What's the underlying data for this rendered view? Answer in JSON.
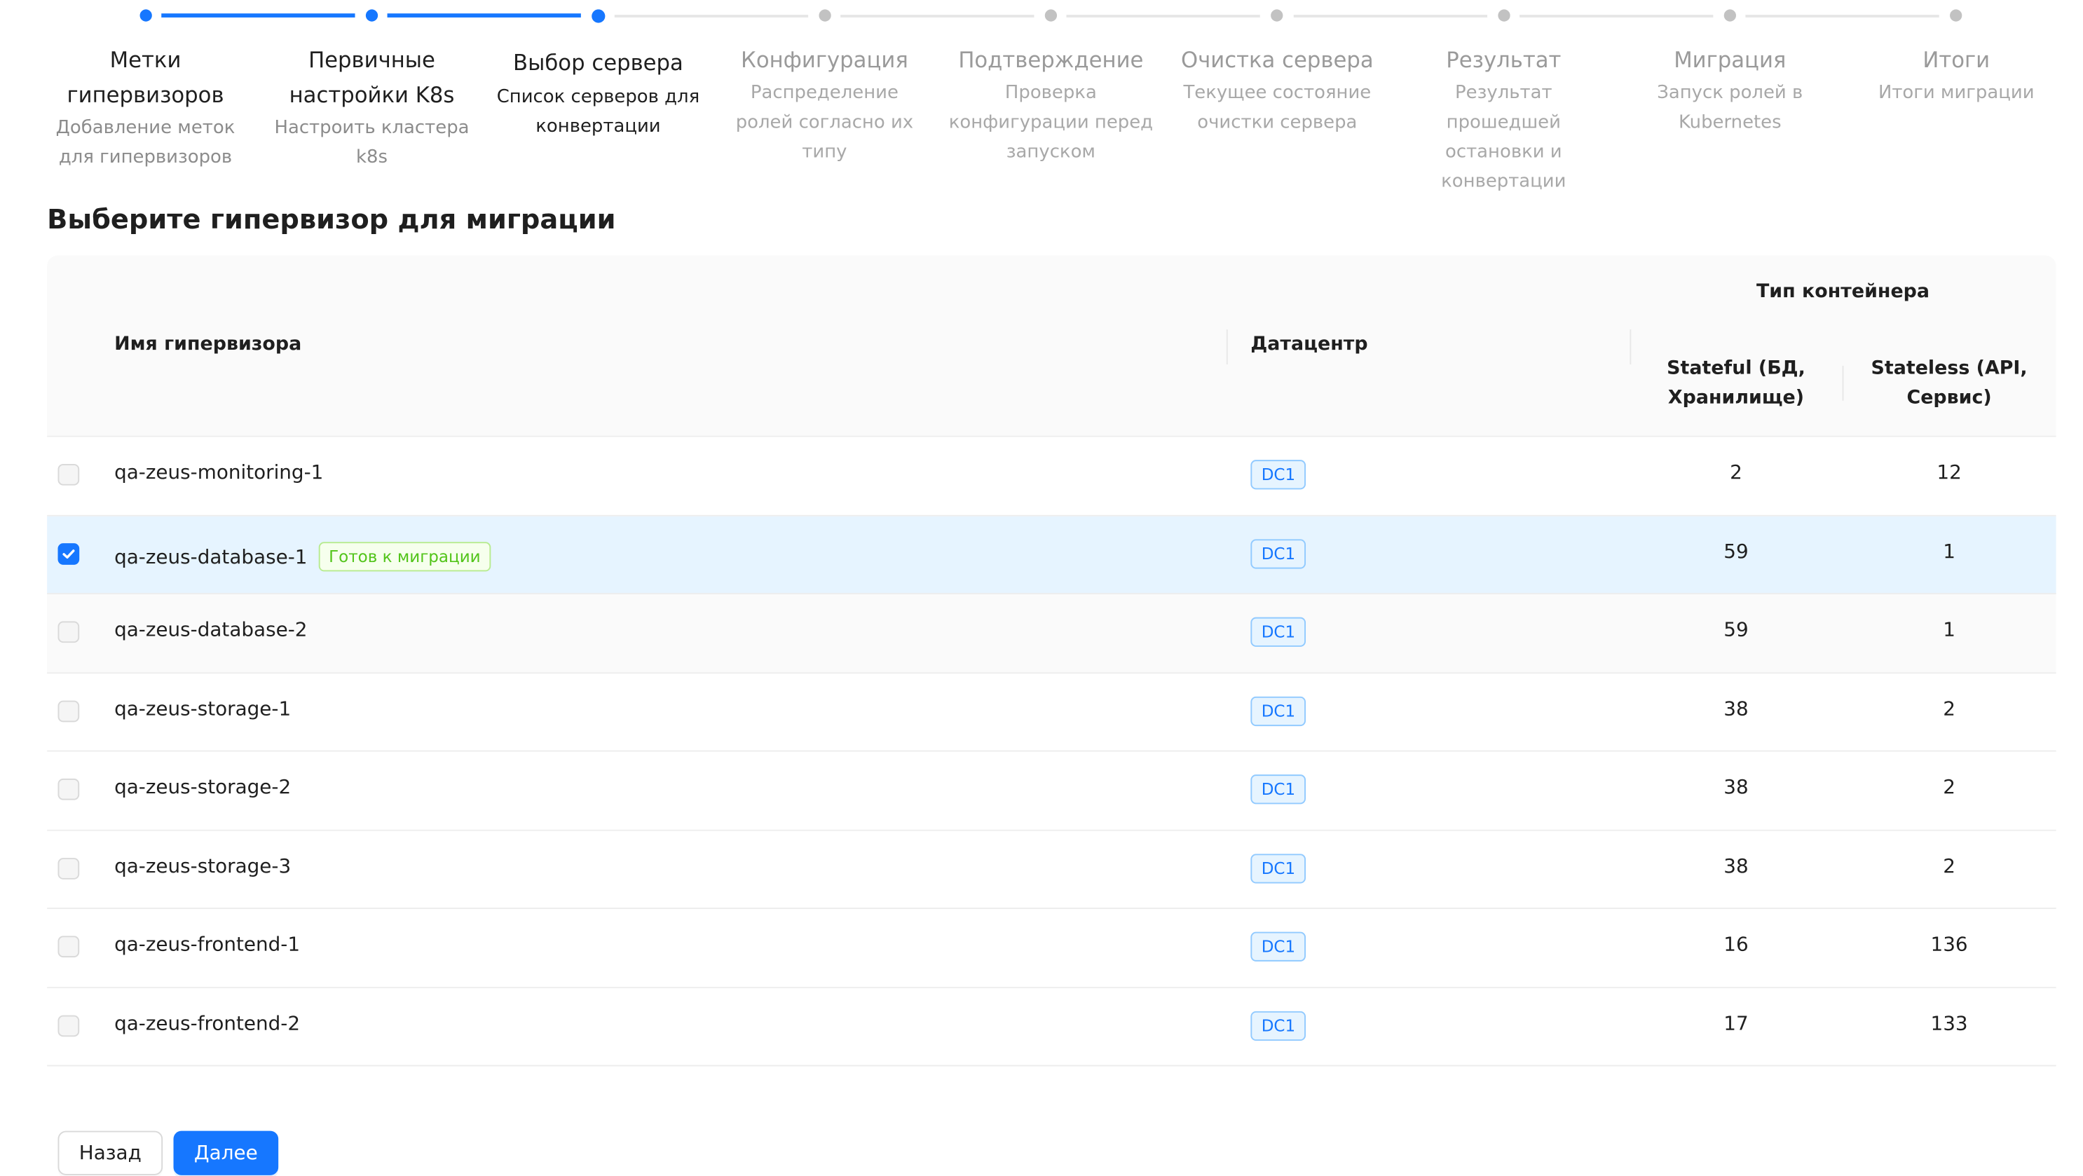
{
  "colors": {
    "primary": "#1677ff",
    "success": "#52c41a",
    "selected_row": "#e6f4ff"
  },
  "steps": [
    {
      "title": "Метки гипервизоров",
      "desc": "Добавление меток для гипервизоров",
      "status": "done"
    },
    {
      "title": "Первичные настройки K8s",
      "desc": "Настроить кластера k8s",
      "status": "done"
    },
    {
      "title": "Выбор сервера",
      "desc": "Список серверов для конвертации",
      "status": "active"
    },
    {
      "title": "Конфигурация",
      "desc": "Распределение ролей согласно их типу",
      "status": "wait"
    },
    {
      "title": "Подтверждение",
      "desc": "Проверка конфигурации перед запуском",
      "status": "wait"
    },
    {
      "title": "Очистка сервера",
      "desc": "Текущее состояние очистки сервера",
      "status": "wait"
    },
    {
      "title": "Результат",
      "desc": "Результат прошедшей остановки и конвертации",
      "status": "wait"
    },
    {
      "title": "Миграция",
      "desc": "Запуск ролей в Kubernetes",
      "status": "wait"
    },
    {
      "title": "Итоги",
      "desc": "Итоги миграции",
      "status": "wait"
    }
  ],
  "page": {
    "heading": "Выберите гипервизор для миграции"
  },
  "table": {
    "columns": {
      "name": "Имя гипервизора",
      "datacenter": "Датацентр",
      "container_type": "Тип контейнера",
      "stateful": "Stateful (БД, Хранилище)",
      "stateless": "Stateless (API, Сервис)"
    },
    "rows": [
      {
        "name": "qa-zeus-monitoring-1",
        "dc": "DC1",
        "stateful": "2",
        "stateless": "12",
        "checked": false,
        "tag": ""
      },
      {
        "name": "qa-zeus-database-1",
        "dc": "DC1",
        "stateful": "59",
        "stateless": "1",
        "checked": true,
        "tag": "Готов к миграции"
      },
      {
        "name": "qa-zeus-database-2",
        "dc": "DC1",
        "stateful": "59",
        "stateless": "1",
        "checked": false,
        "tag": ""
      },
      {
        "name": "qa-zeus-storage-1",
        "dc": "DC1",
        "stateful": "38",
        "stateless": "2",
        "checked": false,
        "tag": ""
      },
      {
        "name": "qa-zeus-storage-2",
        "dc": "DC1",
        "stateful": "38",
        "stateless": "2",
        "checked": false,
        "tag": ""
      },
      {
        "name": "qa-zeus-storage-3",
        "dc": "DC1",
        "stateful": "38",
        "stateless": "2",
        "checked": false,
        "tag": ""
      },
      {
        "name": "qa-zeus-frontend-1",
        "dc": "DC1",
        "stateful": "16",
        "stateless": "136",
        "checked": false,
        "tag": ""
      },
      {
        "name": "qa-zeus-frontend-2",
        "dc": "DC1",
        "stateful": "17",
        "stateless": "133",
        "checked": false,
        "tag": ""
      }
    ]
  },
  "buttons": {
    "back": "Назад",
    "next": "Далее"
  }
}
